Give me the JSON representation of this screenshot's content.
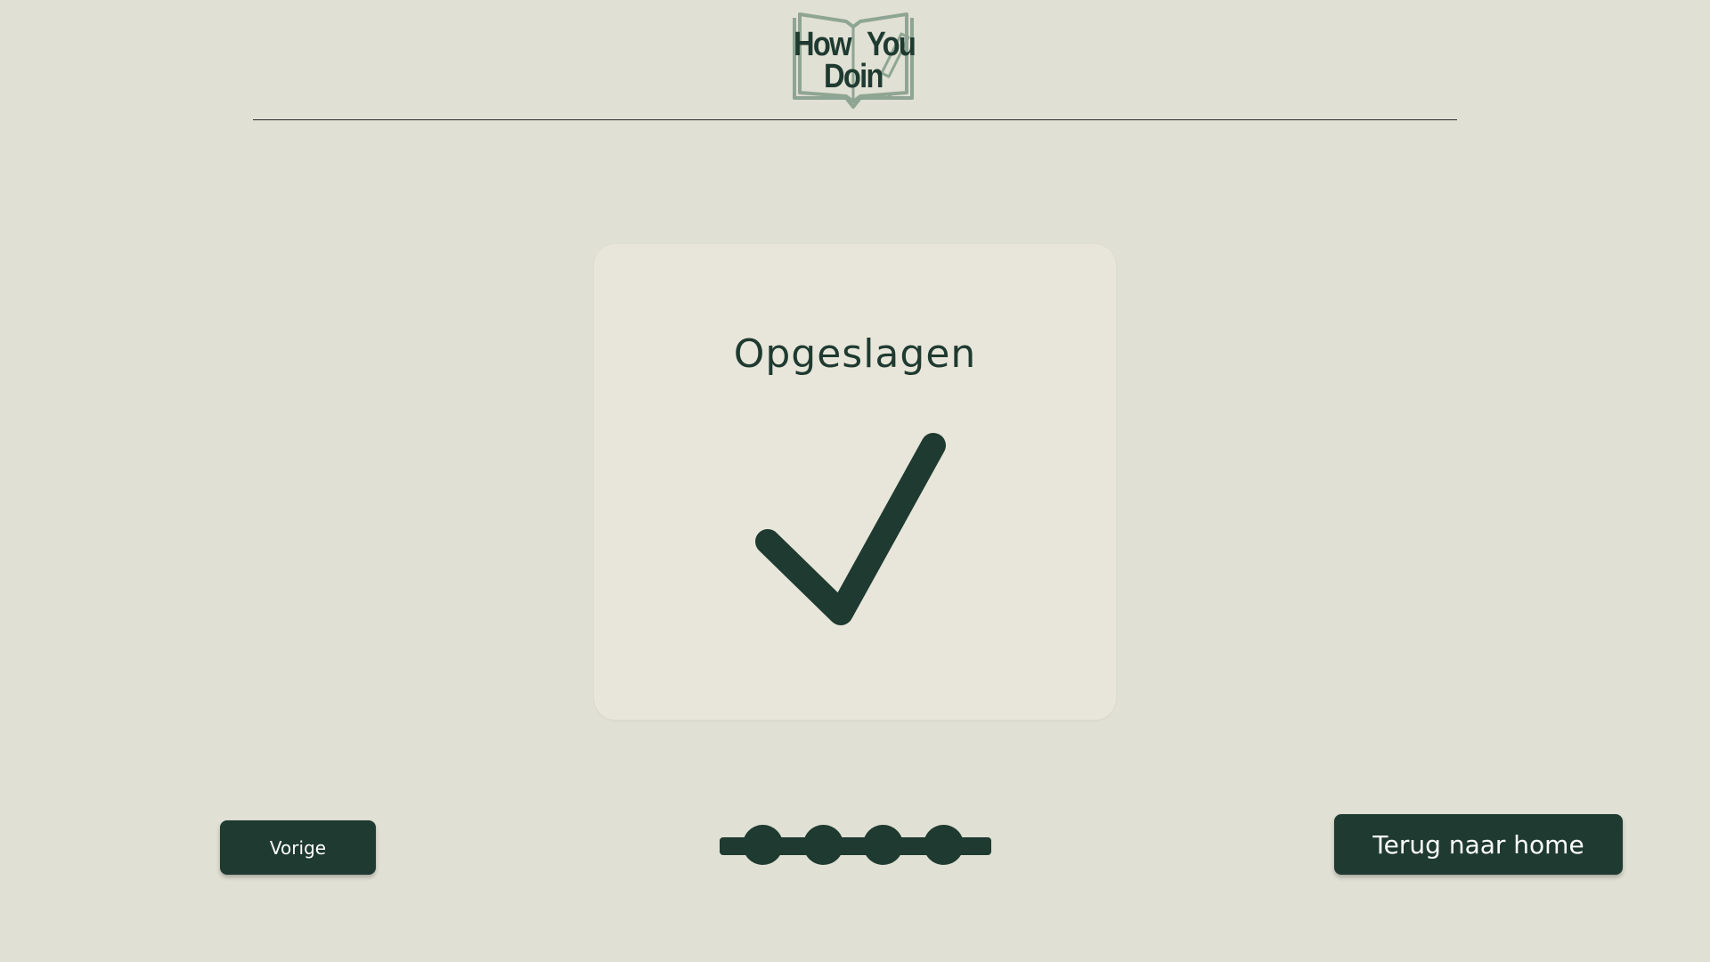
{
  "header": {
    "logo": {
      "line1_left": "How",
      "line1_right": "You",
      "line2": "Doin"
    }
  },
  "card": {
    "title": "Opgeslagen",
    "icon": "checkmark-icon"
  },
  "navigation": {
    "prev_label": "Vorige",
    "home_label": "Terug naar home"
  },
  "progress": {
    "total_steps": 4
  },
  "colors": {
    "background": "#e0e0d4",
    "card": "#e8e6da",
    "accent": "#1f3a30",
    "logo_outline": "#8fa593"
  }
}
